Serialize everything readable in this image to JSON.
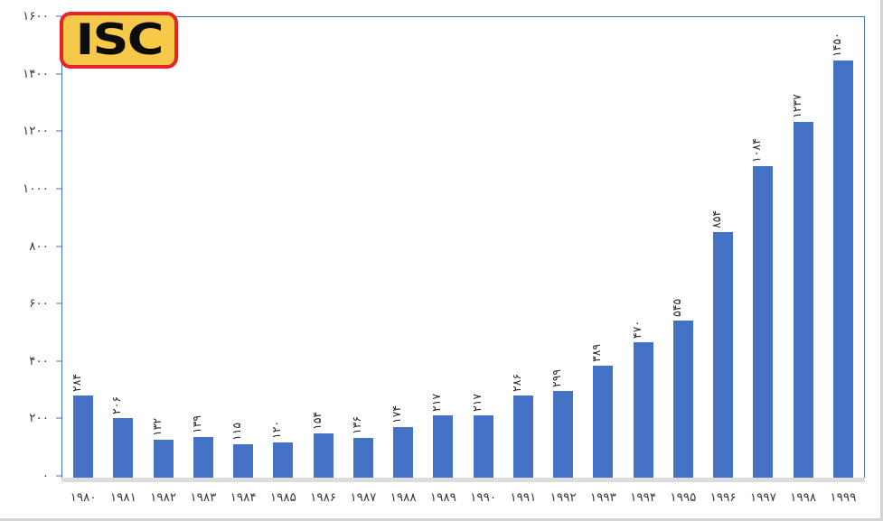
{
  "logo": {
    "text": "ISC",
    "background_color": "#F7C948",
    "border_color": "#E8232A",
    "text_color": "#0d0d0d"
  },
  "chart_data": {
    "type": "bar",
    "title": "",
    "subtitle": "",
    "xlabel": "",
    "ylabel": "",
    "grid": false,
    "legend": null,
    "bar_color": "#4472C4",
    "axis_color": "#4472C4",
    "ylim": [
      0,
      1600
    ],
    "ytick_values": [
      1600,
      1400,
      1200,
      1000,
      800,
      600,
      400,
      200,
      0
    ],
    "ytick_labels": [
      "۱۶۰۰",
      "۱۴۰۰",
      "۱۲۰۰",
      "۱۰۰۰",
      "۸۰۰",
      "۶۰۰",
      "۴۰۰",
      "۲۰۰",
      "۰"
    ],
    "categories": [
      "۱۹۸۰",
      "۱۹۸۱",
      "۱۹۸۲",
      "۱۹۸۳",
      "۱۹۸۴",
      "۱۹۸۵",
      "۱۹۸۶",
      "۱۹۸۷",
      "۱۹۸۸",
      "۱۹۸۹",
      "۱۹۹۰",
      "۱۹۹۱",
      "۱۹۹۲",
      "۱۹۹۳",
      "۱۹۹۴",
      "۱۹۹۵",
      "۱۹۹۶",
      "۱۹۹۷",
      "۱۹۹۸",
      "۱۹۹۹"
    ],
    "values": [
      284,
      206,
      132,
      139,
      115,
      120,
      154,
      136,
      174,
      217,
      217,
      286,
      299,
      389,
      470,
      545,
      854,
      1084,
      1237,
      1450
    ],
    "value_labels": [
      "۲۸۴",
      "۲۰۶",
      "۱۳۲",
      "۱۳۹",
      "۱۱۵",
      "۱۲۰",
      "۱۵۴",
      "۱۳۶",
      "۱۷۴",
      "۲۱۷",
      "۲۱۷",
      "۲۸۶",
      "۲۹۹",
      "۳۸۹",
      "۴۷۰",
      "۵۴۵",
      "۸۵۴",
      "۱۰۸۴",
      "۱۲۳۷",
      "۱۴۵۰"
    ]
  }
}
